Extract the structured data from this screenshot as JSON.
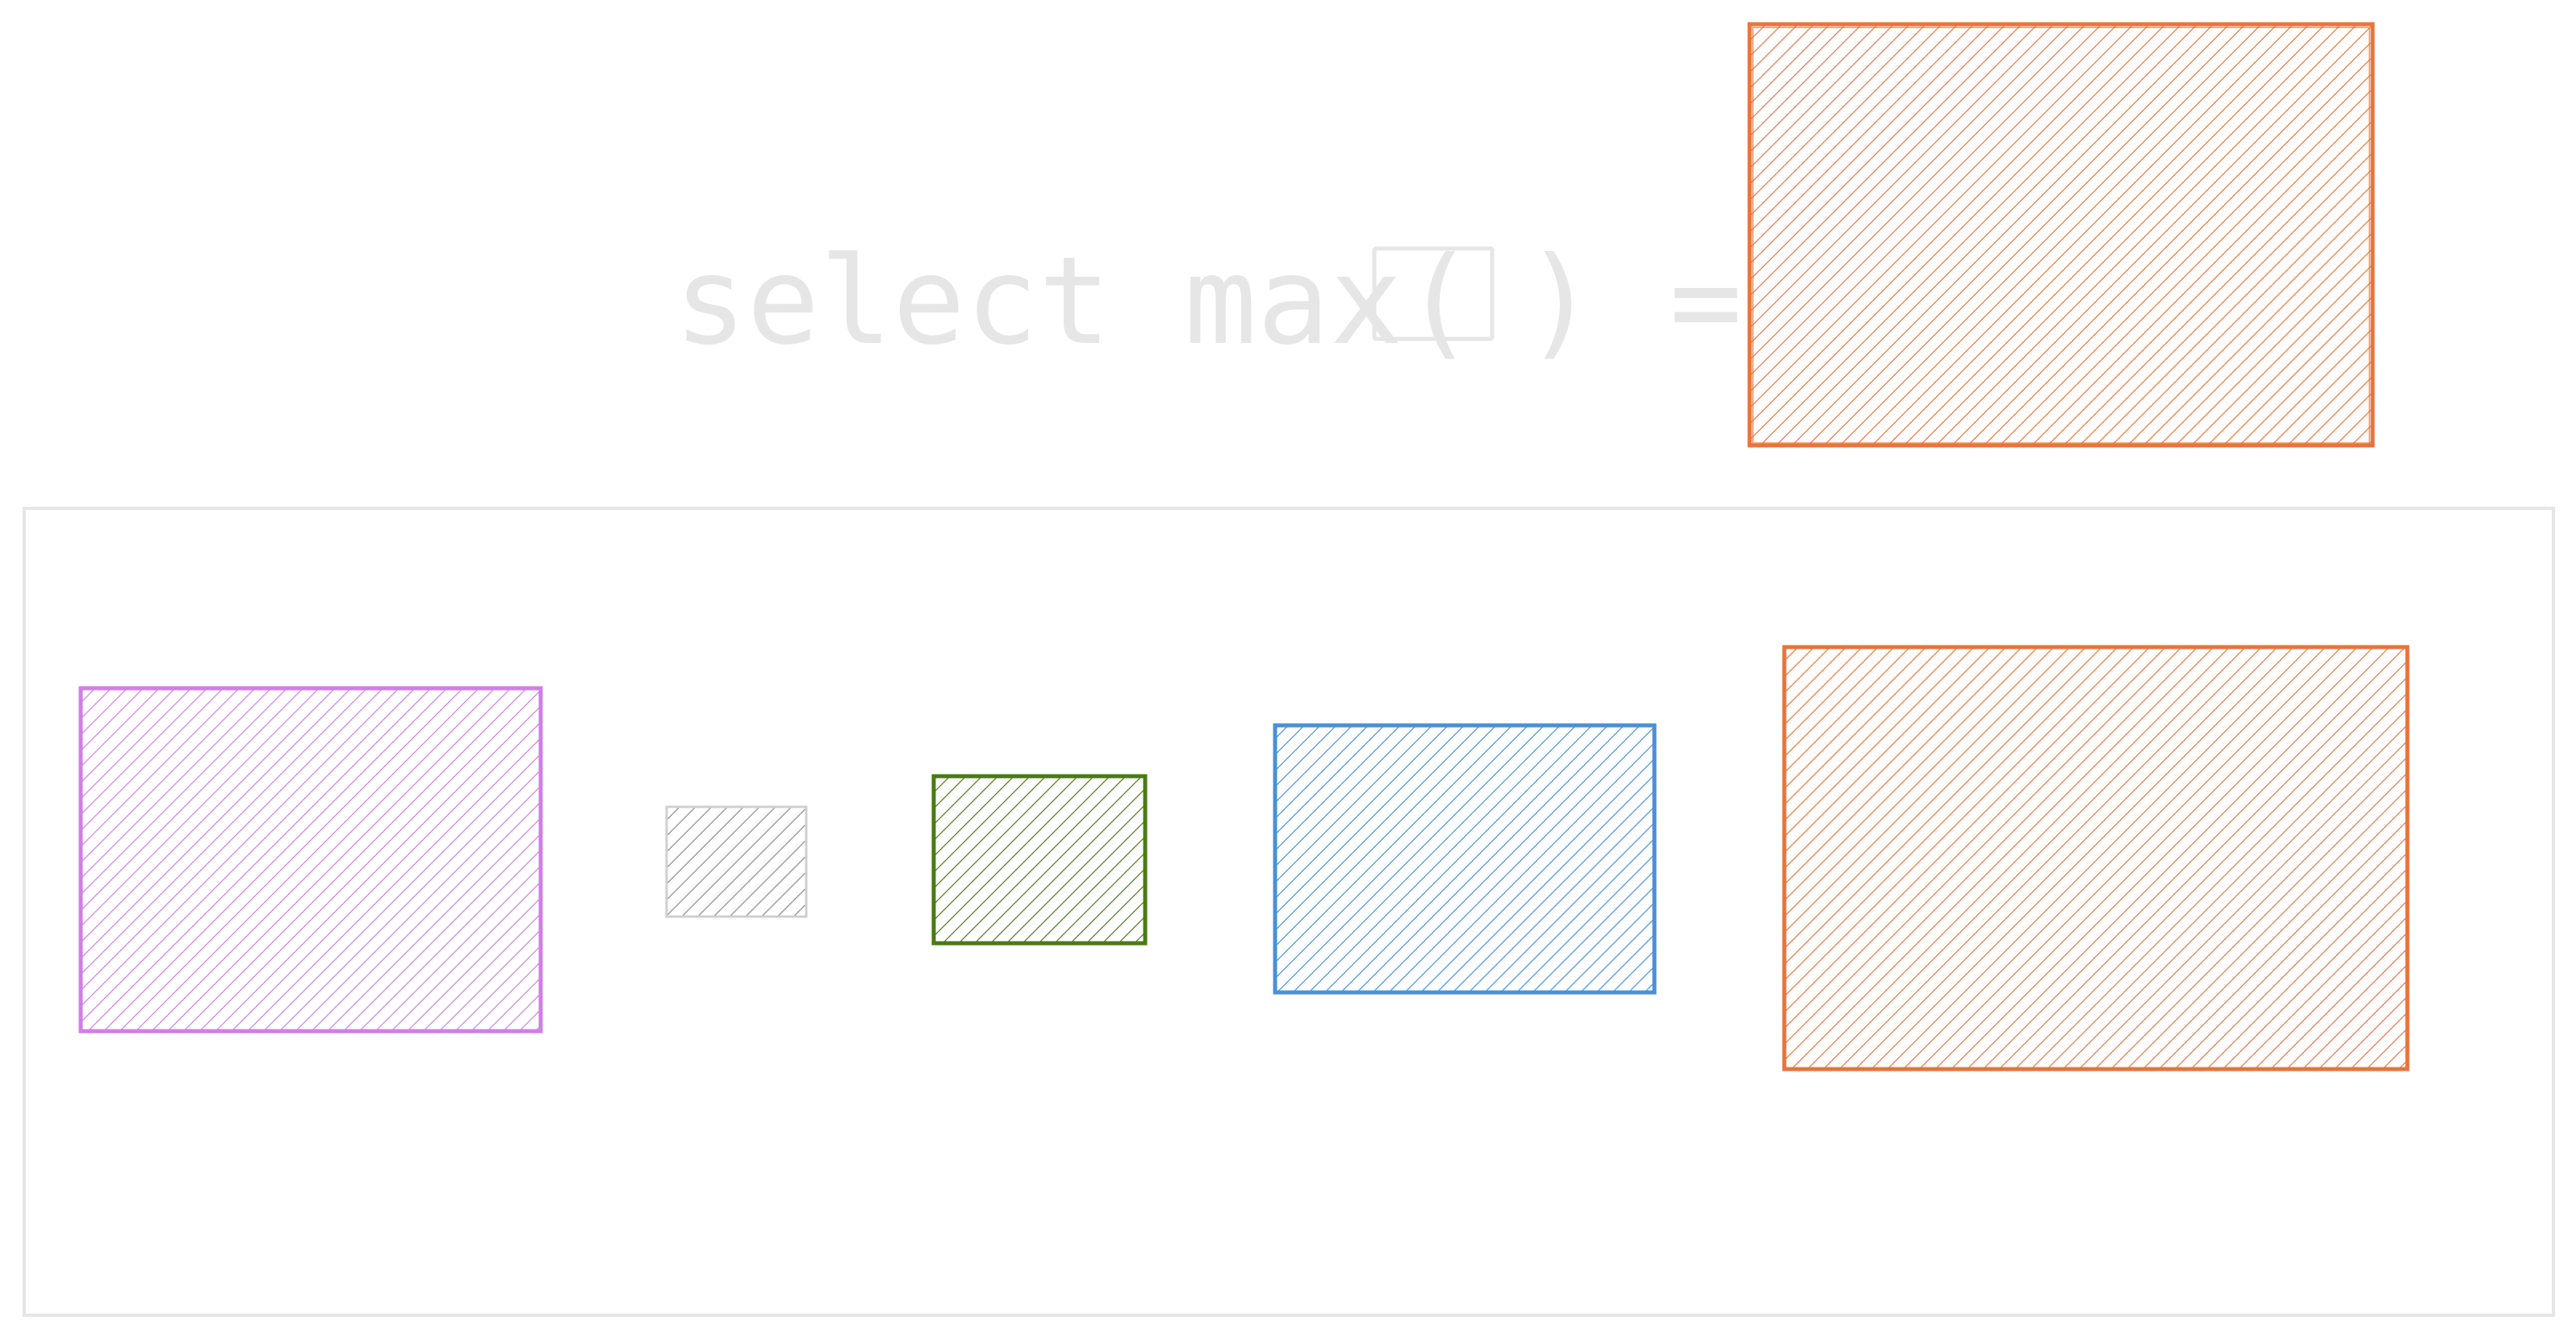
{
  "formula": {
    "prefix": "select max(",
    "suffix": ") =",
    "placeholder_icon": "empty-box-icon",
    "text_color": "#e6e6e6"
  },
  "result": {
    "color": "#e8743b"
  },
  "candidates": {
    "frame_color": "#e6e6e6",
    "items": [
      {
        "name": "purple-rect",
        "color": "#d07ee8"
      },
      {
        "name": "gray-rect",
        "color": "#8a8a8a"
      },
      {
        "name": "green-rect",
        "color": "#4a7a14"
      },
      {
        "name": "blue-rect",
        "color": "#4a90d9"
      },
      {
        "name": "orange-rect",
        "color": "#e8743b"
      }
    ]
  }
}
